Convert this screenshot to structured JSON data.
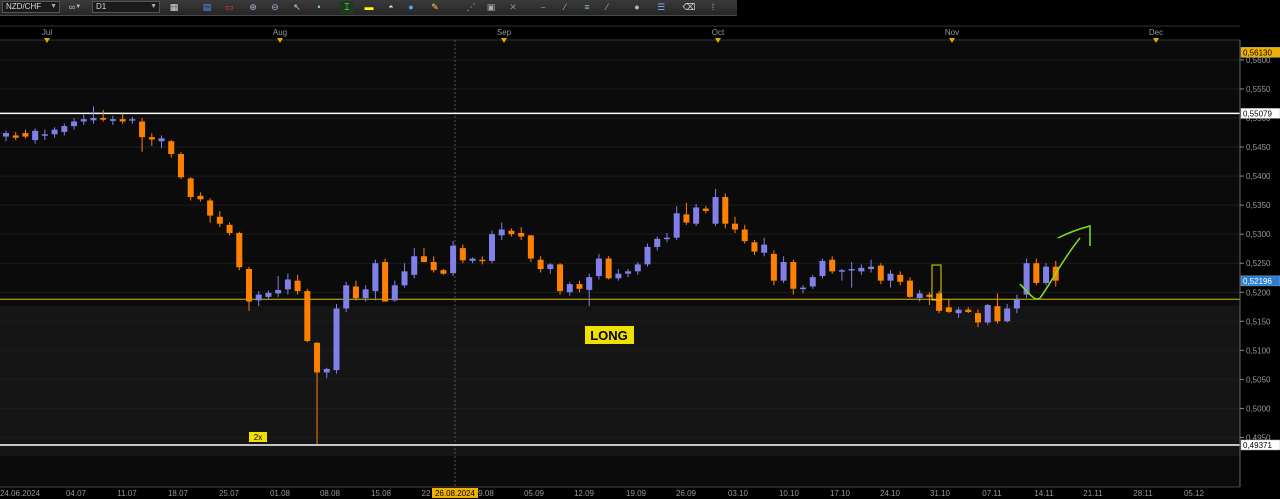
{
  "toolbar": {
    "symbol": "NZD/CHF",
    "timeframe": "D1",
    "link_icon": "∞"
  },
  "top_months": [
    "Jul",
    "Aug",
    "Sep",
    "Oct",
    "Nov",
    "Dec"
  ],
  "bottom_dates": [
    "24.06.2024",
    "04.07",
    "11.07",
    "18.07",
    "25.07",
    "01.08",
    "08.08",
    "15.08",
    "22",
    "26.08.2024",
    "9.08",
    "05.09",
    "12.09",
    "19.09",
    "26.09",
    "03.10",
    "10.10",
    "17.10",
    "24.10",
    "31.10",
    "07.11",
    "14.11",
    "21.11",
    "28.11",
    "05.12"
  ],
  "price_labels": [
    "0,5600",
    "0,5550",
    "0,5500",
    "0,5450",
    "0,5400",
    "0,5350",
    "0,5300",
    "0,5250",
    "0,5200",
    "0,5150",
    "0,5100",
    "0,5050",
    "0,5000",
    "0,4950"
  ],
  "price_markers": {
    "top": "0,56130",
    "resistance": "0,55079",
    "current": "0,52196",
    "support": "0,49371"
  },
  "annotations": {
    "long_label": "LONG",
    "multiplier_badge": "2x"
  },
  "colors": {
    "bull": "#8080e8",
    "bear": "#ff8000",
    "level_line": "#ffffff",
    "price_line": "#d4c000",
    "badge": "#f0e000",
    "arrow": "#80e020",
    "current_price_bg": "#2a7fd4",
    "top_marker_bg": "#f0b000"
  },
  "chart_data": {
    "type": "candlestick",
    "symbol": "NZD/CHF",
    "timeframe": "D1",
    "ylim": [
      0.4925,
      0.5605
    ],
    "horizontal_levels": [
      0.55079,
      0.49371,
      0.5188
    ],
    "candles": [
      {
        "o": 0.5468,
        "h": 0.5478,
        "l": 0.546,
        "c": 0.5474
      },
      {
        "o": 0.547,
        "h": 0.5476,
        "l": 0.5462,
        "c": 0.5466
      },
      {
        "o": 0.5474,
        "h": 0.548,
        "l": 0.5465,
        "c": 0.5468
      },
      {
        "o": 0.5462,
        "h": 0.5482,
        "l": 0.5456,
        "c": 0.5478
      },
      {
        "o": 0.547,
        "h": 0.548,
        "l": 0.5462,
        "c": 0.5472
      },
      {
        "o": 0.5472,
        "h": 0.5484,
        "l": 0.5466,
        "c": 0.548
      },
      {
        "o": 0.5476,
        "h": 0.549,
        "l": 0.547,
        "c": 0.5486
      },
      {
        "o": 0.5486,
        "h": 0.55,
        "l": 0.548,
        "c": 0.5494
      },
      {
        "o": 0.5494,
        "h": 0.5506,
        "l": 0.5488,
        "c": 0.5498
      },
      {
        "o": 0.5496,
        "h": 0.552,
        "l": 0.549,
        "c": 0.55
      },
      {
        "o": 0.55,
        "h": 0.5514,
        "l": 0.5494,
        "c": 0.5497
      },
      {
        "o": 0.5495,
        "h": 0.5504,
        "l": 0.5488,
        "c": 0.5498
      },
      {
        "o": 0.5498,
        "h": 0.5508,
        "l": 0.549,
        "c": 0.5494
      },
      {
        "o": 0.5496,
        "h": 0.5502,
        "l": 0.549,
        "c": 0.5498
      },
      {
        "o": 0.5494,
        "h": 0.55,
        "l": 0.5442,
        "c": 0.5467
      },
      {
        "o": 0.5467,
        "h": 0.5474,
        "l": 0.5452,
        "c": 0.5463
      },
      {
        "o": 0.546,
        "h": 0.547,
        "l": 0.5448,
        "c": 0.5465
      },
      {
        "o": 0.546,
        "h": 0.5462,
        "l": 0.5432,
        "c": 0.5438
      },
      {
        "o": 0.5438,
        "h": 0.5441,
        "l": 0.5395,
        "c": 0.5398
      },
      {
        "o": 0.5396,
        "h": 0.5398,
        "l": 0.5358,
        "c": 0.5364
      },
      {
        "o": 0.5366,
        "h": 0.5372,
        "l": 0.5356,
        "c": 0.536
      },
      {
        "o": 0.5358,
        "h": 0.5362,
        "l": 0.532,
        "c": 0.5332
      },
      {
        "o": 0.533,
        "h": 0.534,
        "l": 0.5312,
        "c": 0.5318
      },
      {
        "o": 0.5316,
        "h": 0.532,
        "l": 0.5298,
        "c": 0.5302
      },
      {
        "o": 0.5302,
        "h": 0.5304,
        "l": 0.5238,
        "c": 0.5243
      },
      {
        "o": 0.524,
        "h": 0.5244,
        "l": 0.5168,
        "c": 0.5184
      },
      {
        "o": 0.5186,
        "h": 0.5202,
        "l": 0.5176,
        "c": 0.5196
      },
      {
        "o": 0.5192,
        "h": 0.5203,
        "l": 0.5188,
        "c": 0.5199
      },
      {
        "o": 0.5198,
        "h": 0.5228,
        "l": 0.5192,
        "c": 0.5204
      },
      {
        "o": 0.5205,
        "h": 0.5232,
        "l": 0.5196,
        "c": 0.5222
      },
      {
        "o": 0.522,
        "h": 0.523,
        "l": 0.5196,
        "c": 0.5202
      },
      {
        "o": 0.5202,
        "h": 0.5206,
        "l": 0.5114,
        "c": 0.5116
      },
      {
        "o": 0.5113,
        "h": 0.5114,
        "l": 0.4938,
        "c": 0.5062
      },
      {
        "o": 0.5062,
        "h": 0.507,
        "l": 0.5052,
        "c": 0.5068
      },
      {
        "o": 0.5066,
        "h": 0.518,
        "l": 0.506,
        "c": 0.5172
      },
      {
        "o": 0.5172,
        "h": 0.5218,
        "l": 0.5166,
        "c": 0.5212
      },
      {
        "o": 0.521,
        "h": 0.522,
        "l": 0.5186,
        "c": 0.519
      },
      {
        "o": 0.519,
        "h": 0.5212,
        "l": 0.5184,
        "c": 0.5205
      },
      {
        "o": 0.5202,
        "h": 0.5256,
        "l": 0.5186,
        "c": 0.525
      },
      {
        "o": 0.5252,
        "h": 0.5258,
        "l": 0.5184,
        "c": 0.5184
      },
      {
        "o": 0.5186,
        "h": 0.522,
        "l": 0.5184,
        "c": 0.5212
      },
      {
        "o": 0.5212,
        "h": 0.525,
        "l": 0.5208,
        "c": 0.5236
      },
      {
        "o": 0.523,
        "h": 0.5276,
        "l": 0.5224,
        "c": 0.5262
      },
      {
        "o": 0.5262,
        "h": 0.5276,
        "l": 0.5256,
        "c": 0.5252
      },
      {
        "o": 0.5252,
        "h": 0.5262,
        "l": 0.5234,
        "c": 0.5238
      },
      {
        "o": 0.5238,
        "h": 0.524,
        "l": 0.523,
        "c": 0.5232
      },
      {
        "o": 0.5233,
        "h": 0.5288,
        "l": 0.5228,
        "c": 0.528
      },
      {
        "o": 0.5276,
        "h": 0.5282,
        "l": 0.525,
        "c": 0.5255
      },
      {
        "o": 0.5254,
        "h": 0.526,
        "l": 0.525,
        "c": 0.5258
      },
      {
        "o": 0.5256,
        "h": 0.5262,
        "l": 0.5248,
        "c": 0.5254
      },
      {
        "o": 0.5254,
        "h": 0.5306,
        "l": 0.525,
        "c": 0.53
      },
      {
        "o": 0.5298,
        "h": 0.532,
        "l": 0.529,
        "c": 0.5308
      },
      {
        "o": 0.5306,
        "h": 0.531,
        "l": 0.5296,
        "c": 0.53
      },
      {
        "o": 0.5302,
        "h": 0.5312,
        "l": 0.529,
        "c": 0.5296
      },
      {
        "o": 0.5298,
        "h": 0.5298,
        "l": 0.5252,
        "c": 0.5258
      },
      {
        "o": 0.5256,
        "h": 0.5262,
        "l": 0.5234,
        "c": 0.524
      },
      {
        "o": 0.524,
        "h": 0.525,
        "l": 0.5232,
        "c": 0.5248
      },
      {
        "o": 0.5248,
        "h": 0.525,
        "l": 0.5196,
        "c": 0.5202
      },
      {
        "o": 0.52,
        "h": 0.5218,
        "l": 0.5194,
        "c": 0.5214
      },
      {
        "o": 0.5214,
        "h": 0.522,
        "l": 0.52,
        "c": 0.5206
      },
      {
        "o": 0.5204,
        "h": 0.5232,
        "l": 0.5176,
        "c": 0.5226
      },
      {
        "o": 0.5228,
        "h": 0.5266,
        "l": 0.5222,
        "c": 0.5258
      },
      {
        "o": 0.5258,
        "h": 0.5262,
        "l": 0.5222,
        "c": 0.5224
      },
      {
        "o": 0.5224,
        "h": 0.524,
        "l": 0.522,
        "c": 0.5232
      },
      {
        "o": 0.5232,
        "h": 0.524,
        "l": 0.5226,
        "c": 0.5236
      },
      {
        "o": 0.5236,
        "h": 0.5252,
        "l": 0.523,
        "c": 0.5248
      },
      {
        "o": 0.5248,
        "h": 0.5284,
        "l": 0.5244,
        "c": 0.5278
      },
      {
        "o": 0.5278,
        "h": 0.5296,
        "l": 0.5272,
        "c": 0.5292
      },
      {
        "o": 0.5292,
        "h": 0.5302,
        "l": 0.5286,
        "c": 0.5294
      },
      {
        "o": 0.5294,
        "h": 0.5348,
        "l": 0.529,
        "c": 0.5336
      },
      {
        "o": 0.5334,
        "h": 0.5354,
        "l": 0.5316,
        "c": 0.532
      },
      {
        "o": 0.5318,
        "h": 0.5352,
        "l": 0.5314,
        "c": 0.5346
      },
      {
        "o": 0.5344,
        "h": 0.5348,
        "l": 0.5336,
        "c": 0.534
      },
      {
        "o": 0.5318,
        "h": 0.5378,
        "l": 0.5314,
        "c": 0.5364
      },
      {
        "o": 0.5364,
        "h": 0.537,
        "l": 0.531,
        "c": 0.5318
      },
      {
        "o": 0.5318,
        "h": 0.533,
        "l": 0.5302,
        "c": 0.5308
      },
      {
        "o": 0.5308,
        "h": 0.5316,
        "l": 0.5284,
        "c": 0.5288
      },
      {
        "o": 0.5286,
        "h": 0.529,
        "l": 0.5264,
        "c": 0.527
      },
      {
        "o": 0.5268,
        "h": 0.5294,
        "l": 0.5262,
        "c": 0.5282
      },
      {
        "o": 0.5266,
        "h": 0.5272,
        "l": 0.5212,
        "c": 0.522
      },
      {
        "o": 0.522,
        "h": 0.5262,
        "l": 0.5216,
        "c": 0.5252
      },
      {
        "o": 0.5252,
        "h": 0.5256,
        "l": 0.5196,
        "c": 0.5206
      },
      {
        "o": 0.5206,
        "h": 0.5212,
        "l": 0.5198,
        "c": 0.5208
      },
      {
        "o": 0.521,
        "h": 0.523,
        "l": 0.5206,
        "c": 0.5226
      },
      {
        "o": 0.5228,
        "h": 0.5258,
        "l": 0.5224,
        "c": 0.5254
      },
      {
        "o": 0.5256,
        "h": 0.5262,
        "l": 0.5232,
        "c": 0.5236
      },
      {
        "o": 0.5236,
        "h": 0.524,
        "l": 0.522,
        "c": 0.5238
      },
      {
        "o": 0.5238,
        "h": 0.5252,
        "l": 0.5208,
        "c": 0.524
      },
      {
        "o": 0.5236,
        "h": 0.5248,
        "l": 0.523,
        "c": 0.5242
      },
      {
        "o": 0.524,
        "h": 0.5256,
        "l": 0.5234,
        "c": 0.5244
      },
      {
        "o": 0.5246,
        "h": 0.525,
        "l": 0.5214,
        "c": 0.522
      },
      {
        "o": 0.522,
        "h": 0.5238,
        "l": 0.5208,
        "c": 0.5232
      },
      {
        "o": 0.523,
        "h": 0.5236,
        "l": 0.5212,
        "c": 0.5218
      },
      {
        "o": 0.522,
        "h": 0.5226,
        "l": 0.519,
        "c": 0.5192
      },
      {
        "o": 0.519,
        "h": 0.5204,
        "l": 0.5184,
        "c": 0.5198
      },
      {
        "o": 0.5196,
        "h": 0.52,
        "l": 0.5178,
        "c": 0.5192
      },
      {
        "o": 0.5198,
        "h": 0.5202,
        "l": 0.5164,
        "c": 0.5168
      },
      {
        "o": 0.5174,
        "h": 0.5188,
        "l": 0.5164,
        "c": 0.5166
      },
      {
        "o": 0.5164,
        "h": 0.5174,
        "l": 0.5156,
        "c": 0.517
      },
      {
        "o": 0.517,
        "h": 0.5174,
        "l": 0.5164,
        "c": 0.5166
      },
      {
        "o": 0.5164,
        "h": 0.517,
        "l": 0.514,
        "c": 0.5148
      },
      {
        "o": 0.5148,
        "h": 0.518,
        "l": 0.5144,
        "c": 0.5178
      },
      {
        "o": 0.5176,
        "h": 0.5198,
        "l": 0.5146,
        "c": 0.515
      },
      {
        "o": 0.515,
        "h": 0.518,
        "l": 0.5148,
        "c": 0.5172
      },
      {
        "o": 0.5172,
        "h": 0.5196,
        "l": 0.5164,
        "c": 0.5188
      },
      {
        "o": 0.5196,
        "h": 0.5258,
        "l": 0.519,
        "c": 0.525
      },
      {
        "o": 0.525,
        "h": 0.5258,
        "l": 0.5212,
        "c": 0.5216
      },
      {
        "o": 0.5216,
        "h": 0.525,
        "l": 0.5212,
        "c": 0.5244
      },
      {
        "o": 0.5244,
        "h": 0.5254,
        "l": 0.521,
        "c": 0.522
      }
    ]
  }
}
